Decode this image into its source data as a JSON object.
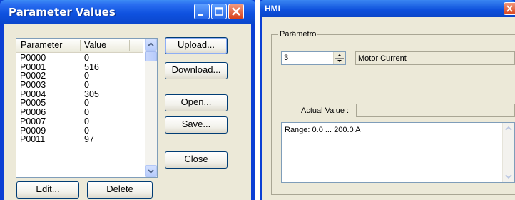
{
  "params_window": {
    "title": "Parameter Values",
    "columns": [
      "Parameter",
      "Value"
    ],
    "rows": [
      {
        "param": "P0000",
        "value": "0"
      },
      {
        "param": "P0001",
        "value": "516"
      },
      {
        "param": "P0002",
        "value": "0"
      },
      {
        "param": "P0003",
        "value": "0"
      },
      {
        "param": "P0004",
        "value": "305"
      },
      {
        "param": "P0005",
        "value": "0"
      },
      {
        "param": "P0006",
        "value": "0"
      },
      {
        "param": "P0007",
        "value": "0"
      },
      {
        "param": "P0009",
        "value": "0"
      },
      {
        "param": "P0011",
        "value": "97"
      }
    ],
    "buttons": {
      "upload": "Upload...",
      "download": "Download...",
      "open": "Open...",
      "save": "Save...",
      "close": "Close",
      "edit": "Edit...",
      "delete": "Delete"
    },
    "icons": [
      "minimize-icon",
      "maximize-icon",
      "close-icon",
      "scroll-up-icon",
      "scroll-down-icon"
    ]
  },
  "hmi_window": {
    "title": "HMI",
    "group_label": "Parâmetro",
    "parameter_number": "3",
    "parameter_name": "Motor Current",
    "actual_value_label": "Actual Value :",
    "actual_value": "",
    "range_text": "Range: 0.0 ... 200.0 A"
  },
  "colors": {
    "xp_title_blue": "#0f52e0",
    "window_face": "#ece9d8",
    "close_red": "#d8421c"
  }
}
